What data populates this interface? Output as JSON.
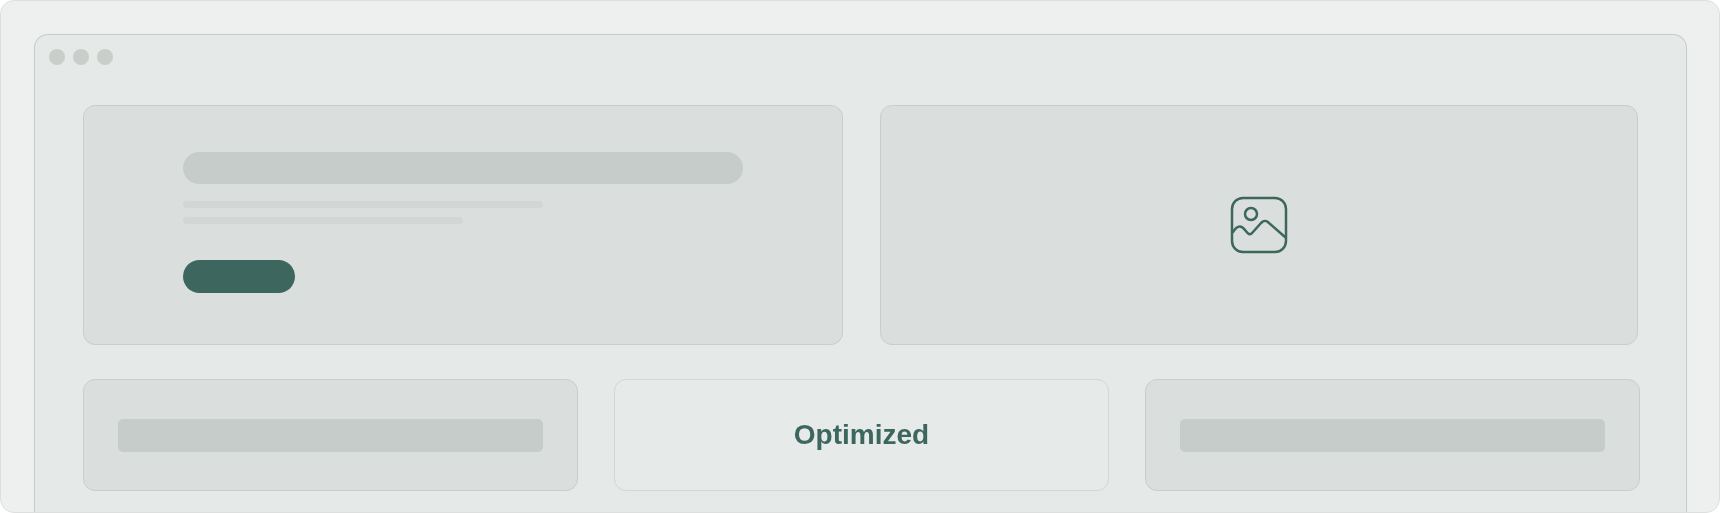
{
  "status_card": {
    "label": "Optimized"
  }
}
